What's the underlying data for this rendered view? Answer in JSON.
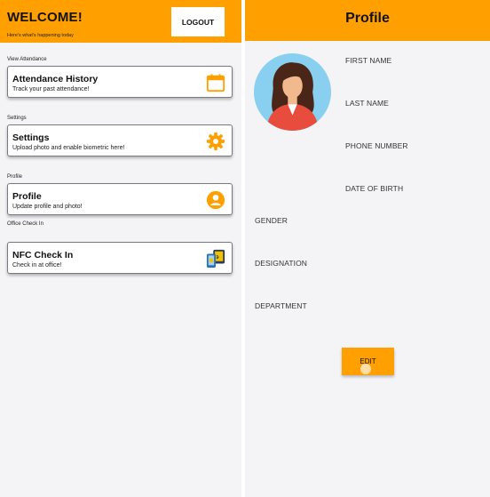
{
  "dashboard": {
    "welcome": "WELCOME!",
    "subtitle": "Here's what's happening today",
    "logout_label": "LOGOUT",
    "sections": [
      {
        "label": "View Attendance",
        "card_title": "Attendance History",
        "card_subtitle": "Track your past attendance!",
        "icon": "calendar-icon"
      },
      {
        "label": "Settings",
        "card_title": "Settings",
        "card_subtitle": "Upload photo and enable biometric here!",
        "icon": "gear-icon"
      },
      {
        "label": "Profile",
        "card_title": "Profile",
        "card_subtitle": "Update profile and photo!",
        "icon": "user-icon"
      },
      {
        "label": "Office Check In",
        "card_title": "NFC Check In",
        "card_subtitle": "Check in at office!",
        "icon": "nfc-icon"
      }
    ]
  },
  "profile": {
    "title": "Profile",
    "fields": [
      "FIRST NAME",
      "LAST NAME",
      "PHONE NUMBER",
      "DATE OF BIRTH",
      "GENDER",
      "DESIGNATION",
      "DEPARTMENT"
    ],
    "edit_label": "EDIT",
    "avatar": "avatar-woman-icon"
  },
  "colors": {
    "accent": "#ffa000",
    "background": "#f4f4f6",
    "avatar_bg": "#89cfef"
  }
}
